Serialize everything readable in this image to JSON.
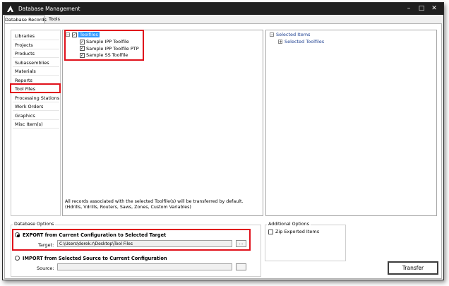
{
  "window": {
    "title": "Database Management"
  },
  "tabs": [
    {
      "label": "Database Records"
    },
    {
      "label": "Tools"
    }
  ],
  "nav": {
    "items": [
      {
        "label": "Libraries"
      },
      {
        "label": "Projects"
      },
      {
        "label": "Products"
      },
      {
        "label": "Subassemblies"
      },
      {
        "label": "Materials"
      },
      {
        "label": "Reports"
      },
      {
        "label": "Tool Files"
      },
      {
        "label": "Processing Stations"
      },
      {
        "label": "Work Orders"
      },
      {
        "label": "Graphics"
      },
      {
        "label": "Misc Item(s)"
      }
    ],
    "selected": "Tool Files"
  },
  "source_tree": {
    "root": "Toolfiles",
    "children": [
      "Sample IPP Toolfile",
      "Sample IPP Toolfile PTP",
      "Sample SS Toolfile"
    ],
    "expand_symbol": "−",
    "check_mark": "✓",
    "note_line1": "All records associated with the selected Toolfile(s) will be transferred by default.",
    "note_line2": "(Hdrills, Vdrills, Routers, Saws, Zones, Custom Variables)"
  },
  "target_tree": {
    "root": "Selected Items",
    "child": "Selected Toolfiles",
    "collapse_symbol": "−",
    "expand_symbol": "+"
  },
  "db_options": {
    "label": "Database Options",
    "export": {
      "label": "EXPORT from Current Configuration to Selected Target",
      "target_label": "Target:",
      "target_value": "C:\\Users\\derek.r\\Desktop\\Tool Files",
      "browse": "..."
    },
    "import": {
      "label": "IMPORT from Selected Source to Current Configuration",
      "source_label": "Source:",
      "source_value": "",
      "browse": ""
    }
  },
  "additional": {
    "label": "Additional Options",
    "zip_label": "Zip Exported Items"
  },
  "transfer_button": "Transfer",
  "colors": {
    "highlight": "#e0111b",
    "selection": "#3399ff",
    "titlebar": "#1f1f1f"
  },
  "icons": {
    "app": "app-logo-icon",
    "minimize": "minimize-icon",
    "maximize": "maximize-icon",
    "close": "close-icon"
  }
}
